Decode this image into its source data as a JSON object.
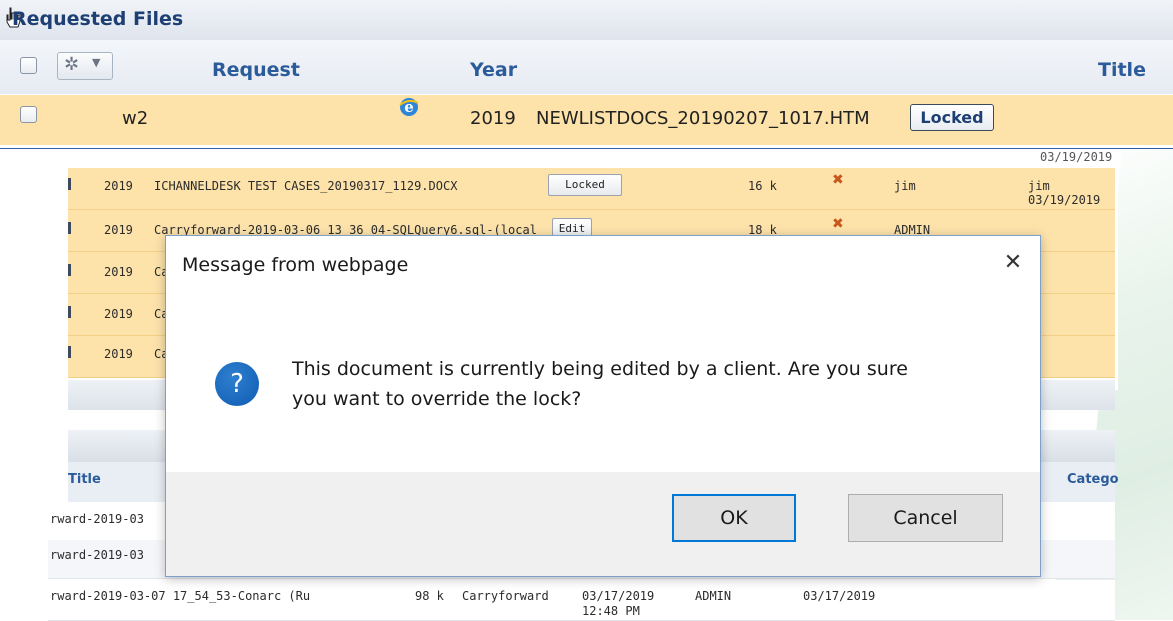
{
  "requested_files": {
    "title": "Requested Files",
    "columns": [
      "Request",
      "Year",
      "Title"
    ],
    "row": {
      "request": "w2",
      "year": "2019",
      "filename": "NEWLISTDOCS_20190207_1017.HTM",
      "button": "Locked"
    }
  },
  "file_list": {
    "partial_date_top": "03/19/2019",
    "rows": [
      {
        "year": "2019",
        "title": "ICHANNELDESK TEST CASES_20190317_1129.DOCX",
        "button": "Locked",
        "size": "16 k",
        "user": "jim",
        "modified_by": "jim",
        "modified_date": "03/19/2019"
      },
      {
        "year": "2019",
        "title": "Carryforward-2019-03-06 13_36_04-SQLQuery6.sql-(local",
        "button": "Edit",
        "size": "18 k",
        "user": "ADMIN"
      },
      {
        "year": "2019",
        "title": "Ca"
      },
      {
        "year": "2019",
        "title": "Ca"
      },
      {
        "year": "2019",
        "title": "Ca"
      }
    ]
  },
  "lower_table": {
    "columns": [
      "Title",
      "Catego"
    ],
    "rows": [
      {
        "title": "rward-2019-03"
      },
      {
        "title": "rward-2019-03"
      },
      {
        "title": "rward-2019-03-07 17_54_53-Conarc (Ru",
        "size": "98 k",
        "category": "Carryforward",
        "date": "03/17/2019",
        "time": "12:48 PM",
        "user": "ADMIN",
        "modified": "03/17/2019"
      }
    ]
  },
  "dialog": {
    "title": "Message from webpage",
    "close_glyph": "✕",
    "icon_glyph": "?",
    "message_line1": "This document is currently being edited by a client. Are you sure",
    "message_line2": "you want to override the lock?",
    "ok_label": "OK",
    "cancel_label": "Cancel"
  },
  "colors": {
    "row_highlight": "#fde3aa",
    "header_text": "#2b5b9a",
    "dialog_border": "#7da0cb",
    "ok_focus": "#0078d7"
  },
  "icons": [
    "cursor-icon",
    "gear-icon",
    "caret-down-icon",
    "ie-icon",
    "delete-x-icon",
    "question-icon",
    "close-icon"
  ]
}
